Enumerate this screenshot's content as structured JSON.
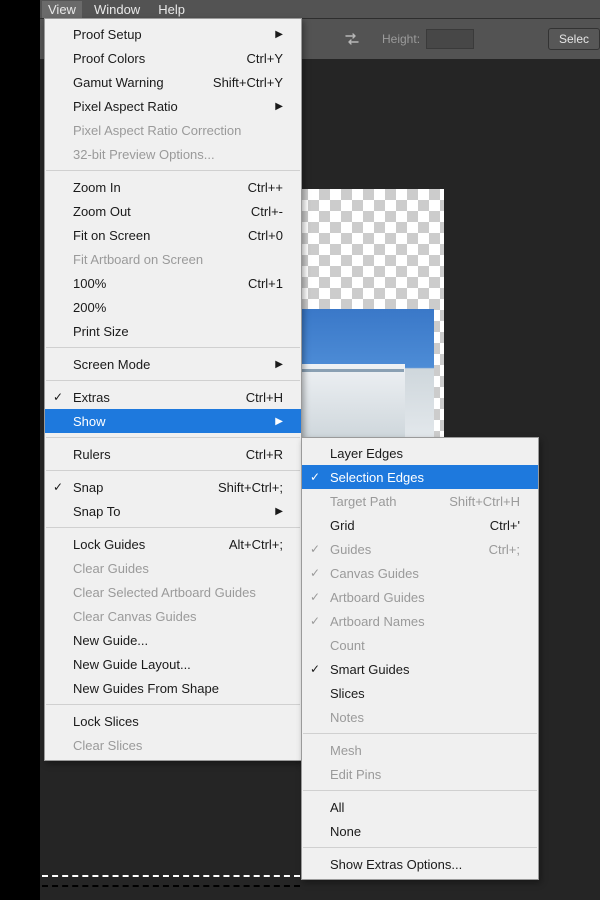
{
  "menubar": {
    "view": "View",
    "window": "Window",
    "help": "Help"
  },
  "toolbar": {
    "height_label": "Height:",
    "select_label": "Selec"
  },
  "view_menu": [
    {
      "t": "item",
      "label": "Proof Setup",
      "arrow": true
    },
    {
      "t": "item",
      "label": "Proof Colors",
      "sc": "Ctrl+Y"
    },
    {
      "t": "item",
      "label": "Gamut Warning",
      "sc": "Shift+Ctrl+Y"
    },
    {
      "t": "item",
      "label": "Pixel Aspect Ratio",
      "arrow": true
    },
    {
      "t": "item",
      "label": "Pixel Aspect Ratio Correction",
      "disabled": true
    },
    {
      "t": "item",
      "label": "32-bit Preview Options...",
      "disabled": true
    },
    {
      "t": "sep"
    },
    {
      "t": "item",
      "label": "Zoom In",
      "sc": "Ctrl++"
    },
    {
      "t": "item",
      "label": "Zoom Out",
      "sc": "Ctrl+-"
    },
    {
      "t": "item",
      "label": "Fit on Screen",
      "sc": "Ctrl+0"
    },
    {
      "t": "item",
      "label": "Fit Artboard on Screen",
      "disabled": true
    },
    {
      "t": "item",
      "label": "100%",
      "sc": "Ctrl+1"
    },
    {
      "t": "item",
      "label": "200%"
    },
    {
      "t": "item",
      "label": "Print Size"
    },
    {
      "t": "sep"
    },
    {
      "t": "item",
      "label": "Screen Mode",
      "arrow": true
    },
    {
      "t": "sep"
    },
    {
      "t": "item",
      "label": "Extras",
      "sc": "Ctrl+H",
      "check": true
    },
    {
      "t": "item",
      "label": "Show",
      "arrow": true,
      "hover": true
    },
    {
      "t": "sep"
    },
    {
      "t": "item",
      "label": "Rulers",
      "sc": "Ctrl+R"
    },
    {
      "t": "sep"
    },
    {
      "t": "item",
      "label": "Snap",
      "sc": "Shift+Ctrl+;",
      "check": true
    },
    {
      "t": "item",
      "label": "Snap To",
      "arrow": true
    },
    {
      "t": "sep"
    },
    {
      "t": "item",
      "label": "Lock Guides",
      "sc": "Alt+Ctrl+;"
    },
    {
      "t": "item",
      "label": "Clear Guides",
      "disabled": true
    },
    {
      "t": "item",
      "label": "Clear Selected Artboard Guides",
      "disabled": true
    },
    {
      "t": "item",
      "label": "Clear Canvas Guides",
      "disabled": true
    },
    {
      "t": "item",
      "label": "New Guide..."
    },
    {
      "t": "item",
      "label": "New Guide Layout..."
    },
    {
      "t": "item",
      "label": "New Guides From Shape"
    },
    {
      "t": "sep"
    },
    {
      "t": "item",
      "label": "Lock Slices"
    },
    {
      "t": "item",
      "label": "Clear Slices",
      "disabled": true
    }
  ],
  "show_menu": [
    {
      "t": "item",
      "label": "Layer Edges"
    },
    {
      "t": "item",
      "label": "Selection Edges",
      "check": true,
      "hover": true
    },
    {
      "t": "item",
      "label": "Target Path",
      "sc": "Shift+Ctrl+H",
      "disabled": true
    },
    {
      "t": "item",
      "label": "Grid",
      "sc": "Ctrl+'"
    },
    {
      "t": "item",
      "label": "Guides",
      "sc": "Ctrl+;",
      "check": true,
      "disabled": true
    },
    {
      "t": "item",
      "label": "Canvas Guides",
      "check": true,
      "disabled": true
    },
    {
      "t": "item",
      "label": "Artboard Guides",
      "check": true,
      "disabled": true
    },
    {
      "t": "item",
      "label": "Artboard Names",
      "check": true,
      "disabled": true
    },
    {
      "t": "item",
      "label": "Count",
      "disabled": true
    },
    {
      "t": "item",
      "label": "Smart Guides",
      "check": true
    },
    {
      "t": "item",
      "label": "Slices"
    },
    {
      "t": "item",
      "label": "Notes",
      "disabled": true
    },
    {
      "t": "sep"
    },
    {
      "t": "item",
      "label": "Mesh",
      "disabled": true
    },
    {
      "t": "item",
      "label": "Edit Pins",
      "disabled": true
    },
    {
      "t": "sep"
    },
    {
      "t": "item",
      "label": "All"
    },
    {
      "t": "item",
      "label": "None"
    },
    {
      "t": "sep"
    },
    {
      "t": "item",
      "label": "Show Extras Options..."
    }
  ]
}
